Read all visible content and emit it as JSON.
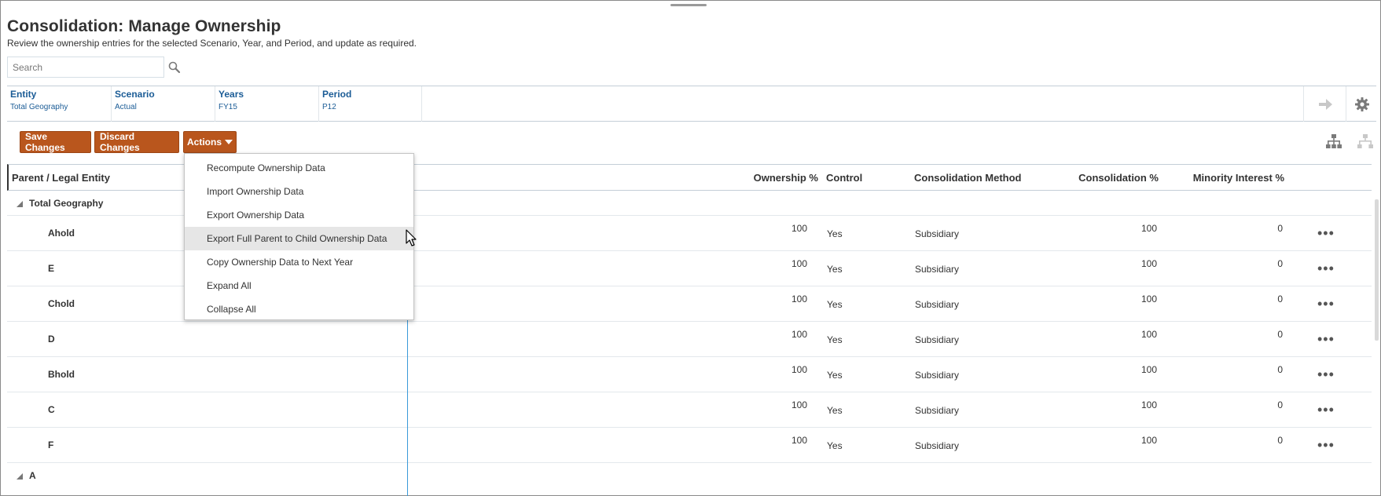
{
  "page": {
    "title": "Consolidation: Manage Ownership",
    "subtitle": "Review the ownership entries for the selected Scenario, Year, and Period, and update as required."
  },
  "search": {
    "placeholder": "Search",
    "icon": "search-icon"
  },
  "pov": [
    {
      "label": "Entity",
      "value": "Total Geography"
    },
    {
      "label": "Scenario",
      "value": "Actual"
    },
    {
      "label": "Years",
      "value": "FY15"
    },
    {
      "label": "Period",
      "value": "P12"
    }
  ],
  "pov_actions": {
    "go_icon": "arrow-right-icon",
    "settings_icon": "gear-icon"
  },
  "toolbar": {
    "save_label": "Save Changes",
    "discard_label": "Discard Changes",
    "actions_label": "Actions"
  },
  "actions_menu": [
    "Recompute Ownership Data",
    "Import Ownership Data",
    "Export Ownership Data",
    "Export Full Parent to Child Ownership Data",
    "Copy Ownership Data to Next Year",
    "Expand All",
    "Collapse All"
  ],
  "grid": {
    "columns": {
      "entity": "Parent / Legal Entity",
      "ownership": "Ownership %",
      "control": "Control",
      "method": "Consolidation Method",
      "consolidation": "Consolidation %",
      "minority": "Minority Interest %"
    },
    "group_name": "Total Geography",
    "rows": [
      {
        "name": "Ahold",
        "ownership": "100",
        "control": "Yes",
        "method": "Subsidiary",
        "consolidation": "100",
        "minority": "0"
      },
      {
        "name": "E",
        "ownership": "100",
        "control": "Yes",
        "method": "Subsidiary",
        "consolidation": "100",
        "minority": "0"
      },
      {
        "name": "Chold",
        "ownership": "100",
        "control": "Yes",
        "method": "Subsidiary",
        "consolidation": "100",
        "minority": "0"
      },
      {
        "name": "D",
        "ownership": "100",
        "control": "Yes",
        "method": "Subsidiary",
        "consolidation": "100",
        "minority": "0"
      },
      {
        "name": "Bhold",
        "ownership": "100",
        "control": "Yes",
        "method": "Subsidiary",
        "consolidation": "100",
        "minority": "0"
      },
      {
        "name": "C",
        "ownership": "100",
        "control": "Yes",
        "method": "Subsidiary",
        "consolidation": "100",
        "minority": "0"
      },
      {
        "name": "F",
        "ownership": "100",
        "control": "Yes",
        "method": "Subsidiary",
        "consolidation": "100",
        "minority": "0"
      }
    ],
    "next_group_name": "A",
    "row_action": "•••"
  },
  "colors": {
    "accent": "#b9561d",
    "link": "#1b5c96",
    "column_marker": "#3a9ad9"
  }
}
